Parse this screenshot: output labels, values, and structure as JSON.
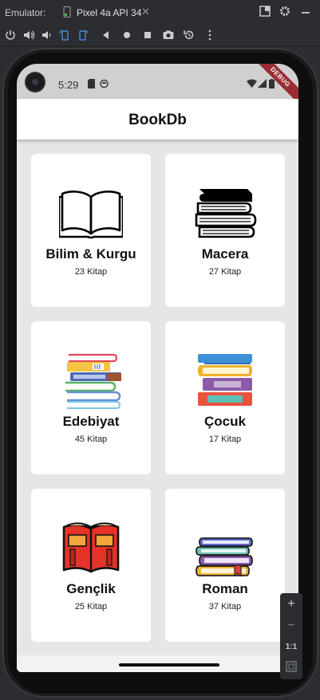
{
  "emulator": {
    "label": "Emulator:",
    "tab_name": "Pixel 4a API 34",
    "tab_close": "✕"
  },
  "status_bar": {
    "time": "5:29",
    "debug_banner": "DEBUG"
  },
  "app": {
    "title": "BookDb",
    "categories": [
      {
        "name": "Bilim & Kurgu",
        "count": "23 Kitap",
        "icon": "open-book-icon"
      },
      {
        "name": "Macera",
        "count": "27 Kitap",
        "icon": "book-stack-icon"
      },
      {
        "name": "Edebiyat",
        "count": "45 Kitap",
        "icon": "colorful-book-pile-icon"
      },
      {
        "name": "Çocuk",
        "count": "17 Kitap",
        "icon": "book-stack-color-icon"
      },
      {
        "name": "Gençlik",
        "count": "25 Kitap",
        "icon": "red-open-book-icon"
      },
      {
        "name": "Roman",
        "count": "37 Kitap",
        "icon": "small-book-stack-icon"
      }
    ]
  },
  "zoom_panel": {
    "plus": "+",
    "minus": "−",
    "ratio": "1:1"
  },
  "colors": {
    "accent_tab": "#4e8bd6",
    "debug_ribbon": "#9b2c33",
    "background": "#e6e6e6"
  }
}
